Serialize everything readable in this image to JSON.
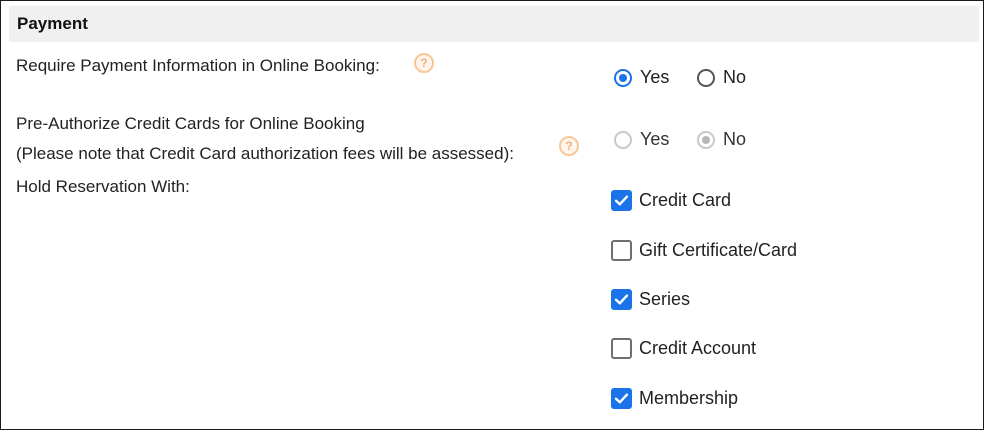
{
  "section": {
    "title": "Payment"
  },
  "require_payment": {
    "label": "Require Payment Information in Online Booking:",
    "yes_label": "Yes",
    "no_label": "No",
    "selected": "Yes"
  },
  "preauth": {
    "label_line1": "Pre-Authorize Credit Cards for Online Booking",
    "label_line2": "(Please note that Credit Card authorization fees will be assessed):",
    "yes_label": "Yes",
    "no_label": "No",
    "selected": "No",
    "disabled": true
  },
  "hold": {
    "label": "Hold Reservation With:",
    "options": [
      {
        "label": "Credit Card",
        "checked": true
      },
      {
        "label": "Gift Certificate/Card",
        "checked": false
      },
      {
        "label": "Series",
        "checked": true
      },
      {
        "label": "Credit Account",
        "checked": false
      },
      {
        "label": "Membership",
        "checked": true
      }
    ]
  },
  "colors": {
    "accent": "#1a73e8",
    "header_bg": "#f0f0f0",
    "help_icon": "#f7c89a"
  }
}
